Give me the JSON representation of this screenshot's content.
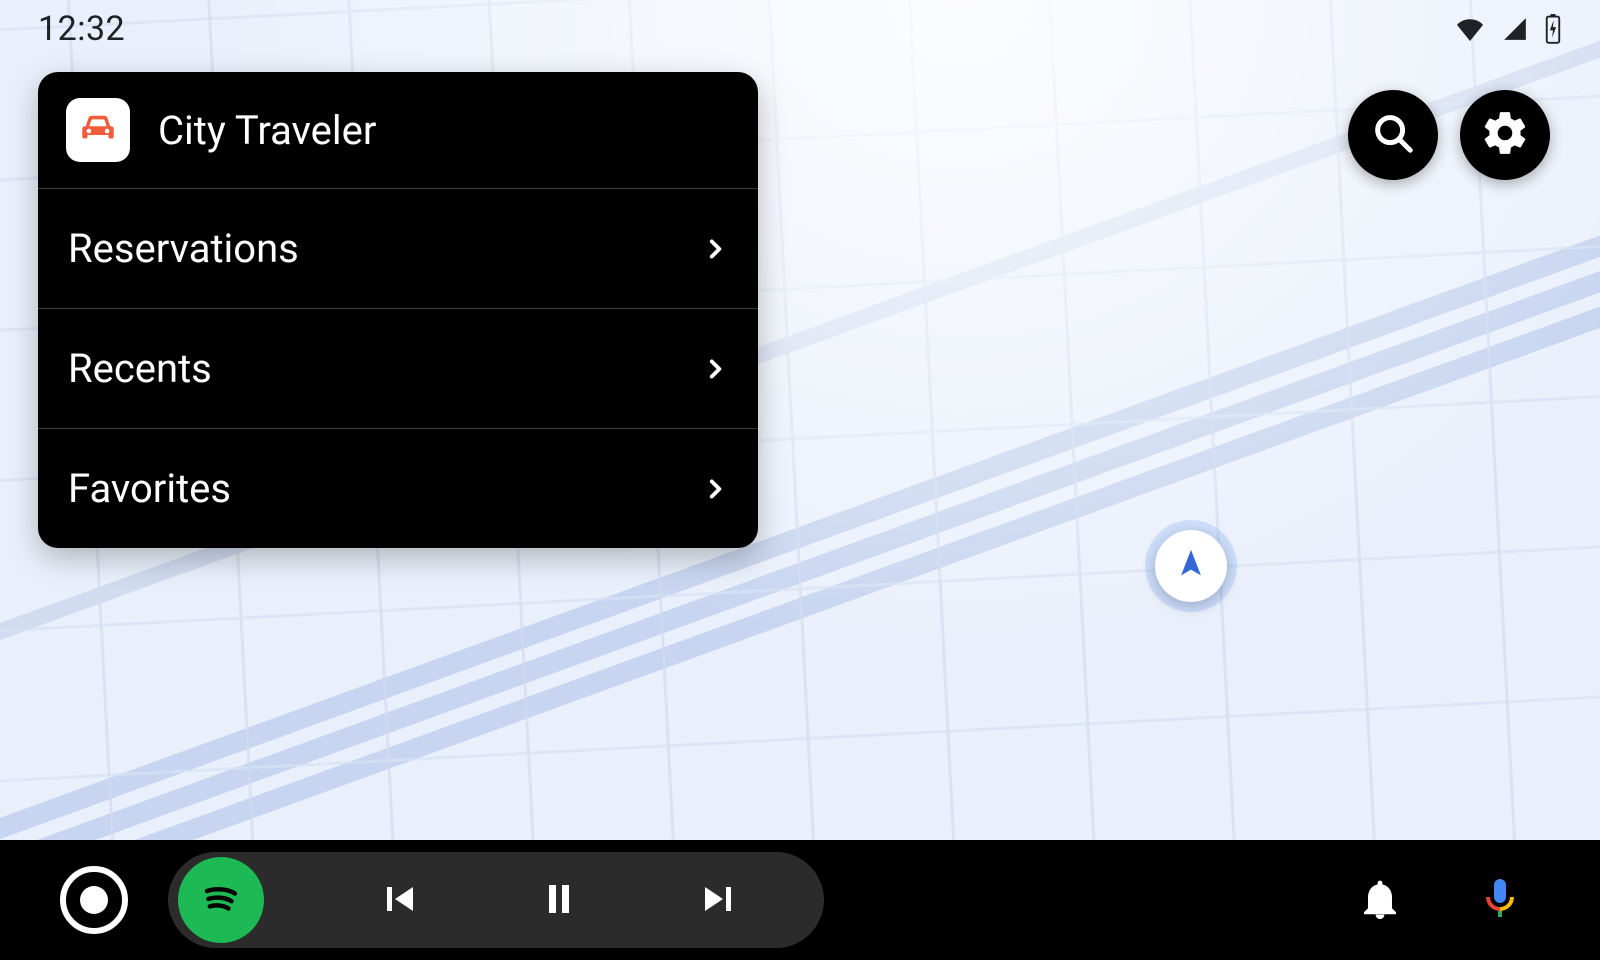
{
  "status": {
    "time": "12:32"
  },
  "panel": {
    "app_name": "City Traveler",
    "items": [
      {
        "label": "Reservations"
      },
      {
        "label": "Recents"
      },
      {
        "label": "Favorites"
      }
    ]
  },
  "fabs": {
    "search": "search",
    "settings": "settings"
  },
  "media": {
    "app": "Spotify",
    "state": "paused"
  },
  "icons": {
    "wifi": "wifi-icon",
    "cellular": "cellular-icon",
    "battery": "battery-charging-icon",
    "car": "car-icon",
    "chevron": "chevron-right-icon",
    "search": "search-icon",
    "gear": "gear-icon",
    "arrow": "navigation-arrow-icon",
    "home": "home-circle-icon",
    "spotify": "spotify-icon",
    "prev": "skip-previous-icon",
    "pause": "pause-icon",
    "next": "skip-next-icon",
    "bell": "bell-icon",
    "mic": "assistant-mic-icon"
  }
}
